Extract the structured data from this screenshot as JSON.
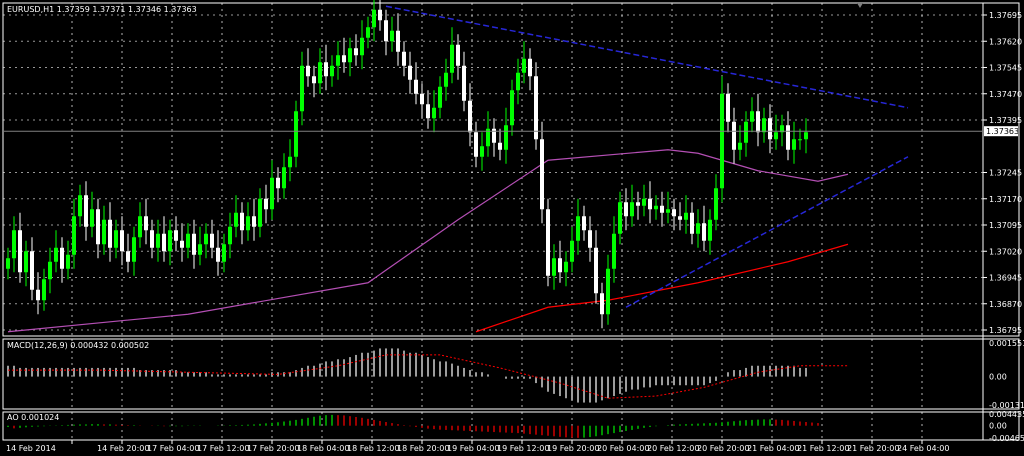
{
  "header": {
    "symbol": "EURUSD,H1",
    "ohlc": "1.37359 1.37371 1.37346 1.37363"
  },
  "indicators": {
    "macd_label": "MACD(12,26,9) 0.000432 0.000502",
    "ao_label": "AO 0.001024"
  },
  "colors": {
    "background": "#000000",
    "bull_candle": "#00ff00",
    "bear_candle": "#ffffff",
    "grid": "#ffffff",
    "ma_slow": "#ff0000",
    "ma_fast": "#b44fb4",
    "trendline": "#2727d8",
    "macd_signal": "#ff0000",
    "current_price_line": "#808080"
  },
  "chart_data": [
    {
      "type": "candlestick",
      "title": "EURUSD,H1",
      "ylim": [
        1.36795,
        1.37695
      ],
      "y_ticks": [
        "1.37695",
        "1.37620",
        "1.37545",
        "1.37470",
        "1.37395",
        "1.37363",
        "1.37245",
        "1.37170",
        "1.37095",
        "1.37020",
        "1.36945",
        "1.36870",
        "1.36795"
      ],
      "current_price": "1.37363",
      "x_ticks": [
        "14 Feb 2014",
        "14 Feb 20:00",
        "17 Feb 04:00",
        "17 Feb 12:00",
        "17 Feb 20:00",
        "18 Feb 04:00",
        "18 Feb 12:00",
        "18 Feb 20:00",
        "19 Feb 04:00",
        "19 Feb 12:00",
        "19 Feb 20:00",
        "20 Feb 04:00",
        "20 Feb 12:00",
        "20 Feb 20:00",
        "21 Feb 04:00",
        "21 Feb 12:00",
        "21 Feb 20:00",
        "24 Feb 04:00"
      ],
      "grid": true,
      "closes": [
        1.37,
        1.3708,
        1.3696,
        1.3702,
        1.3691,
        1.3688,
        1.3694,
        1.3699,
        1.3703,
        1.3697,
        1.3701,
        1.3712,
        1.3718,
        1.3709,
        1.3714,
        1.3704,
        1.3711,
        1.3703,
        1.3708,
        1.3702,
        1.3699,
        1.3706,
        1.3712,
        1.3708,
        1.3703,
        1.3707,
        1.3702,
        1.3708,
        1.3705,
        1.3703,
        1.3707,
        1.3701,
        1.3704,
        1.3707,
        1.3703,
        1.3699,
        1.3704,
        1.3709,
        1.3713,
        1.3708,
        1.3712,
        1.3709,
        1.3717,
        1.3714,
        1.3723,
        1.372,
        1.3726,
        1.3729,
        1.3742,
        1.3755,
        1.3752,
        1.375,
        1.3756,
        1.3752,
        1.3755,
        1.3758,
        1.3756,
        1.376,
        1.3758,
        1.3763,
        1.3766,
        1.3771,
        1.3768,
        1.3762,
        1.3765,
        1.3759,
        1.3755,
        1.3751,
        1.3747,
        1.3744,
        1.374,
        1.3743,
        1.3749,
        1.3753,
        1.3761,
        1.3755,
        1.3745,
        1.3736,
        1.3729,
        1.3732,
        1.3737,
        1.3733,
        1.3731,
        1.3738,
        1.3748,
        1.3753,
        1.3757,
        1.3752,
        1.3734,
        1.3714,
        1.3695,
        1.37,
        1.3696,
        1.3699,
        1.3705,
        1.3712,
        1.3708,
        1.3703,
        1.369,
        1.3684,
        1.3697,
        1.3707,
        1.3716,
        1.3712,
        1.3716,
        1.3715,
        1.3717,
        1.3714,
        1.3715,
        1.3713,
        1.3714,
        1.3712,
        1.3711,
        1.3713,
        1.3707,
        1.371,
        1.3705,
        1.3711,
        1.372,
        1.3747,
        1.3739,
        1.3731,
        1.3733,
        1.3739,
        1.3742,
        1.3736,
        1.374,
        1.3734,
        1.3736,
        1.3738,
        1.3731,
        1.3734,
        1.3734,
        1.3736
      ],
      "overlays": [
        {
          "name": "",
          "color": "#b44fb4",
          "points": [
            [
              0,
              1.3679
            ],
            [
              30,
              1.3684
            ],
            [
              60,
              1.3693
            ],
            [
              75,
              1.3711
            ],
            [
              90,
              1.3728
            ],
            [
              110,
              1.3731
            ],
            [
              115,
              1.373
            ],
            [
              125,
              1.3725
            ],
            [
              135,
              1.3722
            ],
            [
              140,
              1.3724
            ]
          ]
        },
        {
          "name": "",
          "color": "#ff0000",
          "points": [
            [
              78,
              1.3679
            ],
            [
              90,
              1.3686
            ],
            [
              100,
              1.3688
            ],
            [
              115,
              1.3693
            ],
            [
              130,
              1.3699
            ],
            [
              140,
              1.3704
            ]
          ]
        }
      ],
      "trendlines": [
        {
          "from": [
            63,
            1.3772
          ],
          "to": [
            150,
            1.3743
          ]
        },
        {
          "from": [
            103,
            1.3686
          ],
          "to": [
            150,
            1.3729
          ]
        }
      ]
    },
    {
      "type": "histogram",
      "title": "MACD(12,26,9) 0.000432 0.000502",
      "y_ticks": [
        "0.001551",
        "0.00",
        "-0.001313"
      ],
      "ylim": [
        -0.001313,
        0.001551
      ],
      "values": [
        0.0005,
        0.0005,
        0.0004,
        0.0004,
        0.0004,
        0.0004,
        0.0004,
        0.0004,
        0.0004,
        0.0004,
        0.0004,
        0.0004,
        0.0004,
        0.0004,
        0.0004,
        0.0004,
        0.0004,
        0.0004,
        0.0004,
        0.0004,
        0.0004,
        0.0004,
        0.0003,
        0.0003,
        0.0003,
        0.0003,
        0.0003,
        0.0003,
        0.0003,
        0.0002,
        0.0002,
        0.0002,
        0.0002,
        0.0002,
        0.0001,
        0.0001,
        0.0001,
        0.0001,
        0.0001,
        0.0001,
        0.0001,
        0.0001,
        0.0001,
        0.0001,
        0.0002,
        0.0002,
        0.0002,
        0.0002,
        0.0003,
        0.0004,
        0.0005,
        0.0005,
        0.0006,
        0.0007,
        0.0007,
        0.0008,
        0.0008,
        0.0009,
        0.001,
        0.0011,
        0.0011,
        0.0012,
        0.0013,
        0.0013,
        0.0013,
        0.0013,
        0.0012,
        0.0011,
        0.0011,
        0.001,
        0.0009,
        0.0008,
        0.0007,
        0.0007,
        0.0006,
        0.0005,
        0.0004,
        0.0003,
        0.0002,
        0.0002,
        0.0001,
        0.0,
        0.0,
        -0.0001,
        -0.0001,
        -0.0001,
        -0.0001,
        -0.0001,
        -0.0003,
        -0.0005,
        -0.0007,
        -0.0008,
        -0.0009,
        -0.001,
        -0.0011,
        -0.0012,
        -0.0012,
        -0.0012,
        -0.0012,
        -0.0011,
        -0.001,
        -0.0009,
        -0.0008,
        -0.0007,
        -0.0006,
        -0.0006,
        -0.0005,
        -0.0005,
        -0.0004,
        -0.0004,
        -0.0004,
        -0.0004,
        -0.0004,
        -0.0004,
        -0.0004,
        -0.0004,
        -0.0004,
        -0.0003,
        -0.0002,
        0.0,
        0.0002,
        0.0003,
        0.0003,
        0.0004,
        0.0005,
        0.0005,
        0.0005,
        0.0005,
        0.0005,
        0.0005,
        0.0005,
        0.0005,
        0.0004,
        0.0004
      ],
      "signal": [
        [
          0,
          0.0003
        ],
        [
          15,
          0.0003
        ],
        [
          30,
          0.0002
        ],
        [
          45,
          0.0001
        ],
        [
          55,
          0.0005
        ],
        [
          63,
          0.001
        ],
        [
          72,
          0.001
        ],
        [
          82,
          0.0004
        ],
        [
          92,
          -0.0003
        ],
        [
          100,
          -0.001
        ],
        [
          108,
          -0.0009
        ],
        [
          116,
          -0.0005
        ],
        [
          125,
          0.0002
        ],
        [
          132,
          0.0005
        ],
        [
          140,
          0.0005
        ]
      ]
    },
    {
      "type": "histogram",
      "title": "AO 0.001024",
      "y_ticks": [
        "0.004435",
        "0.00",
        "-0.004656"
      ],
      "ylim": [
        -0.004656,
        0.004435
      ],
      "values": [
        -0.0005,
        -0.001,
        -0.0008,
        -0.0006,
        -0.0004,
        -0.0003,
        -0.0002,
        -0.0001,
        0.0001,
        0.0002,
        0.0003,
        0.0004,
        0.0005,
        0.0005,
        0.0006,
        0.0006,
        0.0005,
        0.0005,
        0.0004,
        0.0003,
        0.0002,
        0.0002,
        0.0001,
        0.0,
        -0.0001,
        -0.0001,
        -0.0002,
        -0.0002,
        -0.0002,
        -0.0002,
        -0.0001,
        -0.0001,
        -0.0001,
        0.0,
        0.0,
        0.0001,
        0.0001,
        0.0002,
        0.0002,
        0.0003,
        0.0004,
        0.0005,
        0.0007,
        0.0009,
        0.0011,
        0.0013,
        0.0016,
        0.0019,
        0.0022,
        0.0026,
        0.003,
        0.0034,
        0.0038,
        0.004,
        0.0041,
        0.004,
        0.0039,
        0.0036,
        0.0033,
        0.003,
        0.0026,
        0.0022,
        0.0018,
        0.0014,
        0.001,
        0.0006,
        0.0002,
        -0.0002,
        -0.0005,
        -0.0008,
        -0.0011,
        -0.0013,
        -0.0015,
        -0.0016,
        -0.0017,
        -0.0018,
        -0.0019,
        -0.002,
        -0.0021,
        -0.0022,
        -0.0023,
        -0.0024,
        -0.0025,
        -0.0026,
        -0.0027,
        -0.0028,
        -0.003,
        -0.0032,
        -0.0034,
        -0.0036,
        -0.0038,
        -0.004,
        -0.0042,
        -0.0044,
        -0.0045,
        -0.0046,
        -0.0045,
        -0.0043,
        -0.004,
        -0.0036,
        -0.0032,
        -0.0028,
        -0.0024,
        -0.002,
        -0.0016,
        -0.0012,
        -0.0008,
        -0.0005,
        -0.0002,
        0.0,
        0.0002,
        0.0004,
        0.0005,
        0.0006,
        0.0007,
        0.0008,
        0.0009,
        0.001,
        0.0011,
        0.0013,
        0.0015,
        0.0017,
        0.0019,
        0.0021,
        0.0022,
        0.0023,
        0.0024,
        0.0024,
        0.0023,
        0.0022,
        0.002,
        0.0018,
        0.0016,
        0.0014,
        0.0012,
        0.001
      ]
    }
  ]
}
